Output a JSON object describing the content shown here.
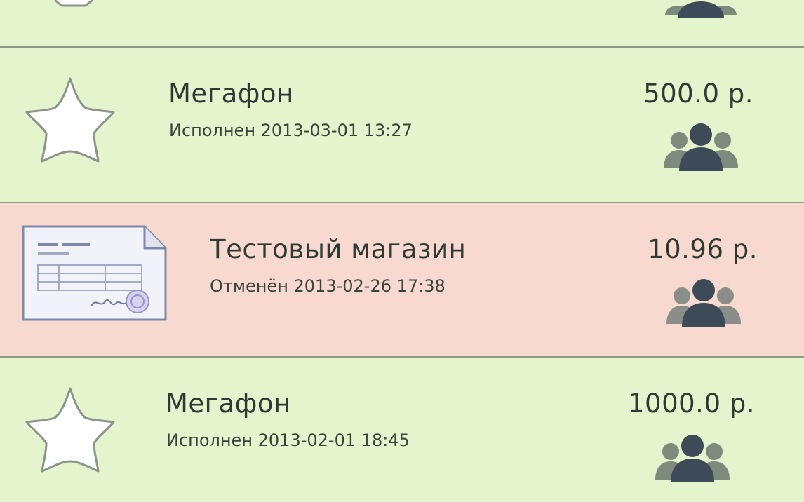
{
  "transactions": [
    {
      "icon": "star-icon",
      "title": "",
      "status_text": "",
      "amount": "",
      "recipient_icon": "group-icon",
      "state": "completed",
      "background": "#e4f4cc"
    },
    {
      "icon": "star-icon",
      "title": "Мегафон",
      "status_text": "Исполнен 2013-03-01 13:27",
      "amount": "500.0 р.",
      "recipient_icon": "group-icon",
      "state": "completed",
      "background": "#e4f4cc"
    },
    {
      "icon": "invoice-document-icon",
      "title": "Тестовый магазин",
      "status_text": "Отменён 2013-02-26 17:38",
      "amount": "10.96 р.",
      "recipient_icon": "group-icon",
      "state": "cancelled",
      "background": "#f7d9cf"
    },
    {
      "icon": "star-icon",
      "title": "Мегафон",
      "status_text": "Исполнен 2013-02-01 18:45",
      "amount": "1000.0 р.",
      "recipient_icon": "group-icon",
      "state": "completed",
      "background": "#e4f4cc"
    }
  ],
  "colors": {
    "completed_bg": "#e4f4cc",
    "cancelled_bg": "#f7d9cf",
    "divider": "#8e9a86",
    "text": "#2f3a34",
    "icon_front": "#3d4a57",
    "icon_back": "#7e8b7c"
  }
}
